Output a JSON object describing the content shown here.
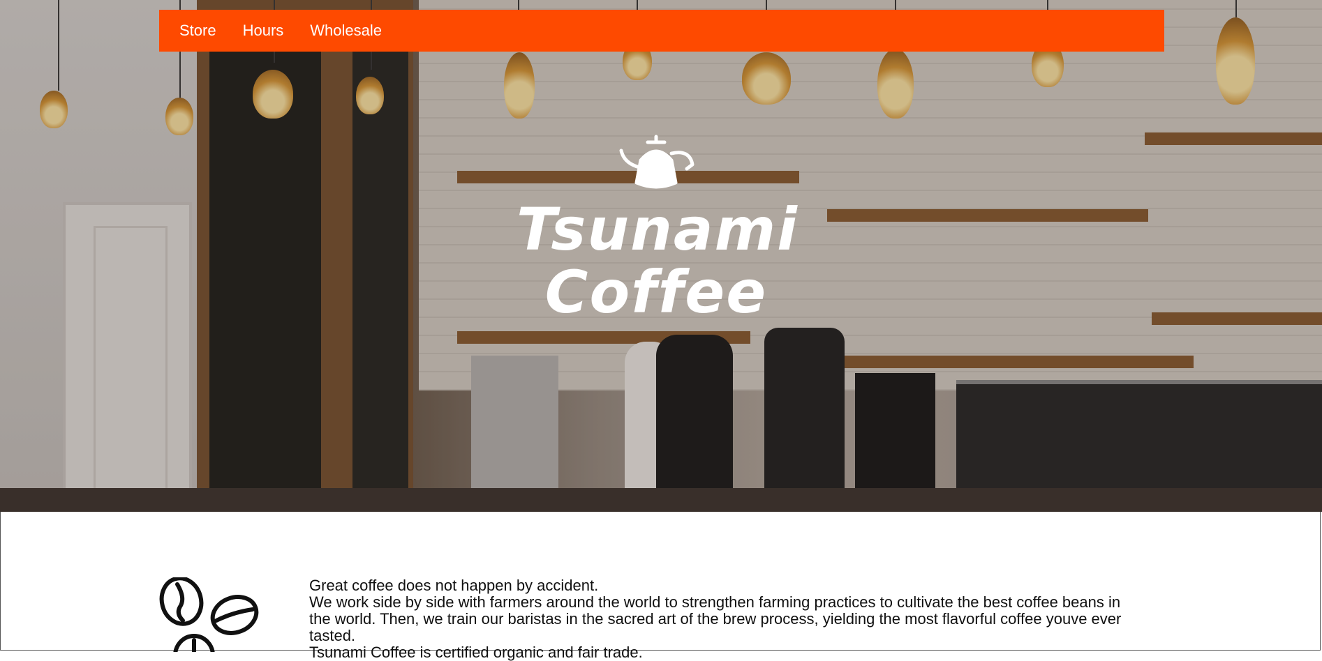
{
  "nav": {
    "items": [
      {
        "label": "Store"
      },
      {
        "label": "Hours"
      },
      {
        "label": "Wholesale"
      }
    ],
    "background": "#fe4a00"
  },
  "hero": {
    "logo_line1": "Tsunami",
    "logo_line2": "Coffee"
  },
  "intro": {
    "line1": "Great coffee does not happen by accident.",
    "line2": "We work side by side with farmers around the world to strengthen farming practices to cultivate the best coffee beans in the world. Then, we train our baristas in the sacred art of the brew process, yielding the most flavorful coffee youve ever tasted.",
    "line3": "Tsunami Coffee is certified organic and fair trade."
  },
  "icons": {
    "logo": "coffee-kettle-icon",
    "beans": "coffee-beans-icon"
  }
}
